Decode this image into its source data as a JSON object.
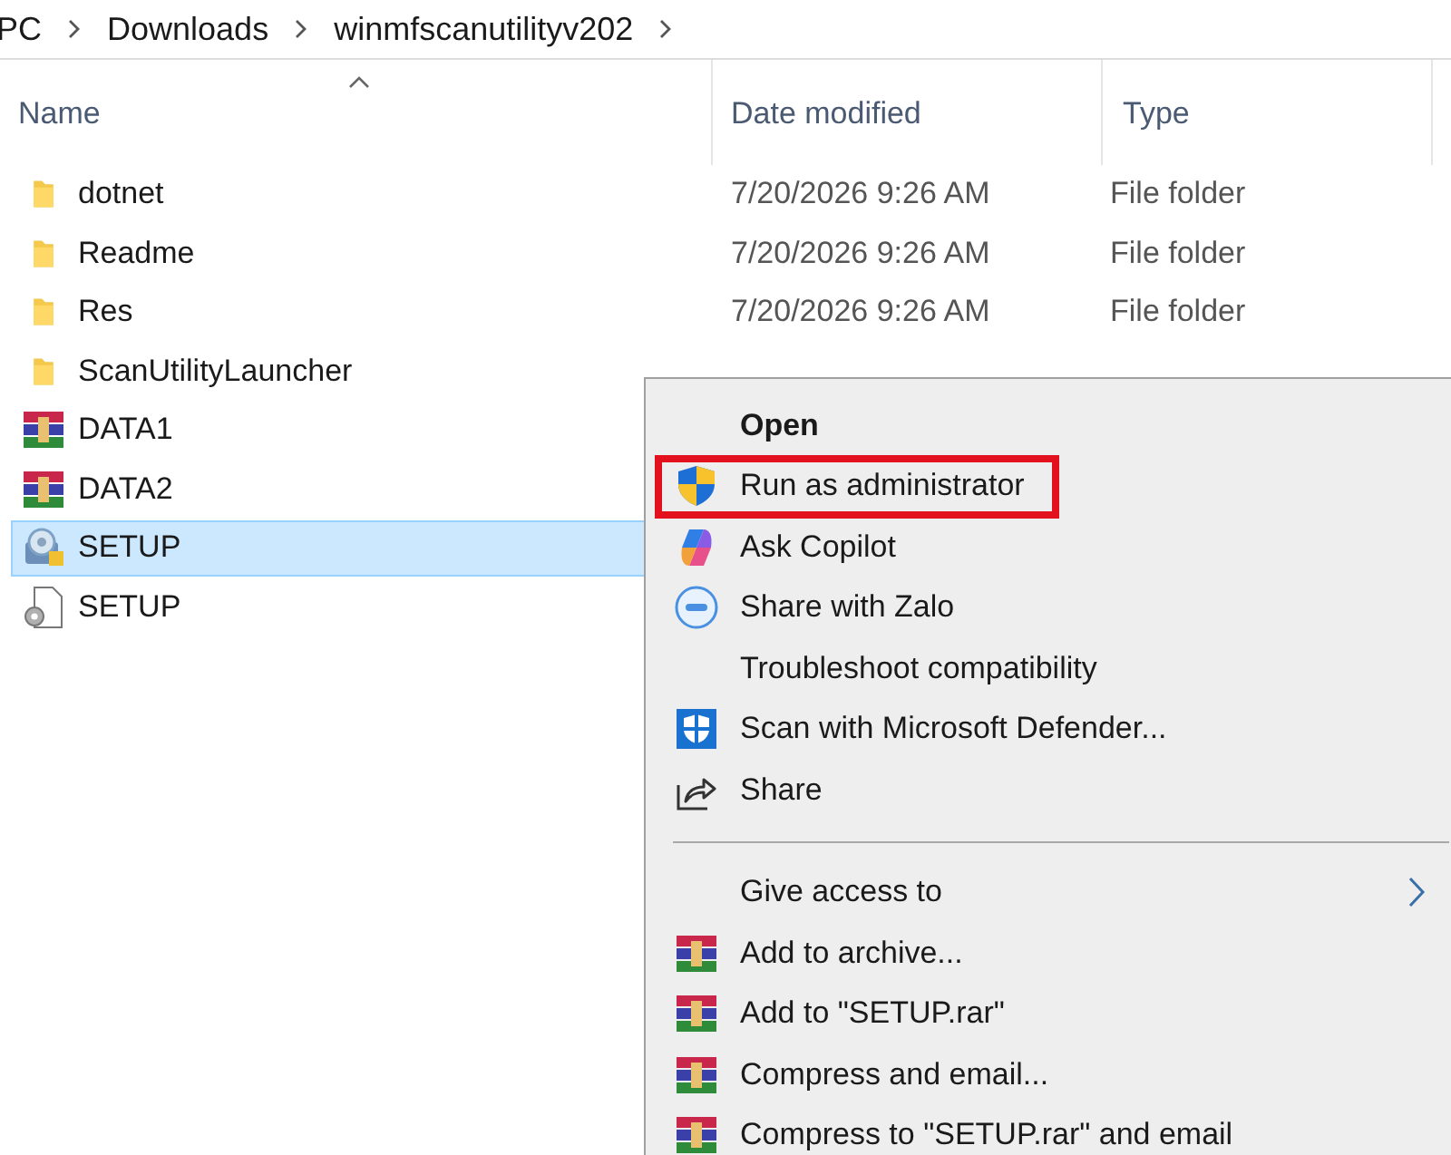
{
  "breadcrumb": [
    "PC",
    "Downloads",
    "winmfscanutilityv202"
  ],
  "columns": [
    {
      "label": "Name",
      "sorted": true
    },
    {
      "label": "Date modified",
      "sorted": false
    },
    {
      "label": "Type",
      "sorted": false
    }
  ],
  "files": [
    {
      "name": "dotnet",
      "kind": "folder",
      "date": "7/20/2026 9:26 AM",
      "type": "File folder",
      "selected": false
    },
    {
      "name": "Readme",
      "kind": "folder",
      "date": "7/20/2026 9:26 AM",
      "type": "File folder",
      "selected": false
    },
    {
      "name": "Res",
      "kind": "folder",
      "date": "7/20/2026 9:26 AM",
      "type": "File folder",
      "selected": false
    },
    {
      "name": "ScanUtilityLauncher",
      "kind": "folder",
      "selected": false
    },
    {
      "name": "DATA1",
      "kind": "archive",
      "selected": false
    },
    {
      "name": "DATA2",
      "kind": "archive",
      "selected": false
    },
    {
      "name": "SETUP",
      "kind": "installer",
      "selected": true
    },
    {
      "name": "SETUP",
      "kind": "file",
      "selected": false
    }
  ],
  "context_menu": [
    {
      "label": "Open",
      "kind": "none",
      "default": true,
      "highlighted": false
    },
    {
      "label": "Run as administrator",
      "kind": "shield",
      "default": false,
      "highlighted": true
    },
    {
      "label": "Ask Copilot",
      "kind": "copilot",
      "default": false,
      "highlighted": false
    },
    {
      "label": "Share with Zalo",
      "kind": "zalo",
      "default": false,
      "highlighted": false
    },
    {
      "label": "Troubleshoot compatibility",
      "kind": "none",
      "default": false,
      "highlighted": false
    },
    {
      "label": "Scan with Microsoft Defender...",
      "kind": "defender",
      "default": false,
      "highlighted": false
    },
    {
      "label": "Share",
      "kind": "share",
      "default": false,
      "highlighted": false
    },
    {
      "kind": "separator"
    },
    {
      "label": "Give access to",
      "kind": "none",
      "default": false,
      "highlighted": false,
      "submenu": true
    },
    {
      "label": "Add to archive...",
      "kind": "archive",
      "default": false,
      "highlighted": false
    },
    {
      "label": "Add to \"SETUP.rar\"",
      "kind": "archive",
      "default": false,
      "highlighted": false
    },
    {
      "label": "Compress and email...",
      "kind": "archive",
      "default": false,
      "highlighted": false
    },
    {
      "label": "Compress to \"SETUP.rar\" and email",
      "kind": "archive",
      "default": false,
      "highlighted": false
    }
  ]
}
